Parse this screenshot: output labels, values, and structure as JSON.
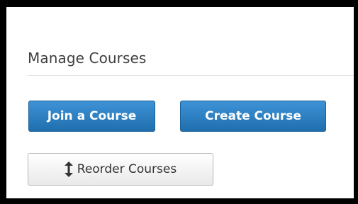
{
  "manage_courses": {
    "title": "Manage Courses",
    "join_label": "Join a Course",
    "create_label": "Create Course",
    "reorder_label": "Reorder Courses",
    "reorder_icon": "up-down-arrow-icon"
  },
  "colors": {
    "primary_button": "#2a7fc4",
    "secondary_button": "#f2f2f2",
    "frame": "#000000"
  }
}
